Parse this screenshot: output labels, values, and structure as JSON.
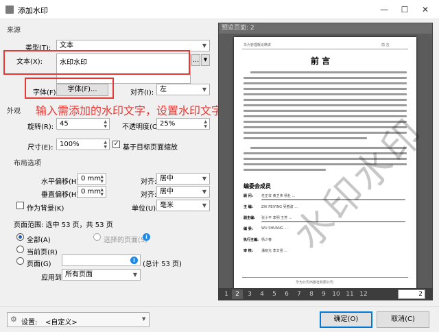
{
  "window": {
    "title": "添加水印",
    "controls": {
      "minimize": "—",
      "maximize": "☐",
      "close": "✕"
    }
  },
  "source": {
    "group_label": "来源",
    "type_label": "类型(T):",
    "type_value": "文本",
    "text_label": "文本(X):",
    "text_value": "水印水印",
    "more_button": "...",
    "font_label": "字体(F):",
    "font_button": "字体(F)...",
    "align_label": "对齐(I):",
    "align_value": "左"
  },
  "annotation": "输入需添加的水印文字，设置水印文字字体",
  "appearance": {
    "group_label": "外观",
    "rotation_label": "旋转(R):",
    "rotation_value": "45",
    "opacity_label": "不透明度(O):",
    "opacity_value": "25%",
    "size_label": "尺寸(E):",
    "size_value": "100%",
    "scale_checkbox_label": "基于目标页面缩放",
    "scale_checked": true
  },
  "layout": {
    "group_label": "布局选项",
    "h_offset_label": "水平偏移(H):",
    "h_offset_value": "0 mm",
    "h_align_label": "对齐:",
    "h_align_value": "居中",
    "v_offset_label": "垂直偏移(H):",
    "v_offset_value": "0 mm",
    "v_align_label": "对齐:",
    "v_align_value": "居中",
    "background_label": "作为背景(K)",
    "unit_label": "单位(U):",
    "unit_value": "毫米"
  },
  "page_range": {
    "heading": "页面范围: 选中 53 页，共 53 页",
    "all_label": "全部(A)",
    "selected_pages_label": "选择的页面(S)",
    "current_label": "当前页(R)",
    "pages_label": "页面(G)",
    "pages_value": "",
    "total_label": "(总计 53 页)",
    "apply_label": "应用到:",
    "apply_value": "所有页面"
  },
  "preview": {
    "header": "预览页面: 2",
    "page_header_left": "华为管理概论精讲",
    "page_header_right": "前 言",
    "heading": "前 言",
    "section_title": "编委会成员",
    "editor_rows": [
      {
        "label": "顾 问:",
        "names": "任正非 黄卫伟 杨杜 ..."
      },
      {
        "label": "主 编:",
        "names": "ZHI PEIYING 吴春波 ..."
      },
      {
        "label": "副主编:",
        "names": "张小平 李明 王芳 ..."
      },
      {
        "label": "编 委:",
        "names": "WU SHUANG ..."
      },
      {
        "label": "执行主编:",
        "names": "杨少春"
      },
      {
        "label": "审 核:",
        "names": "潘晓光 李文强 ..."
      }
    ],
    "footer": "华为公司出版社有限公司",
    "watermark": "水印水印",
    "pages": [
      "1",
      "2",
      "3",
      "4",
      "5",
      "6",
      "7",
      "8",
      "9",
      "10",
      "11",
      "12"
    ],
    "current_page": "2"
  },
  "bottom": {
    "settings_label": "设置:",
    "settings_value": "<自定义>",
    "ok_button": "确定(O)",
    "cancel_button": "取消(C)"
  }
}
